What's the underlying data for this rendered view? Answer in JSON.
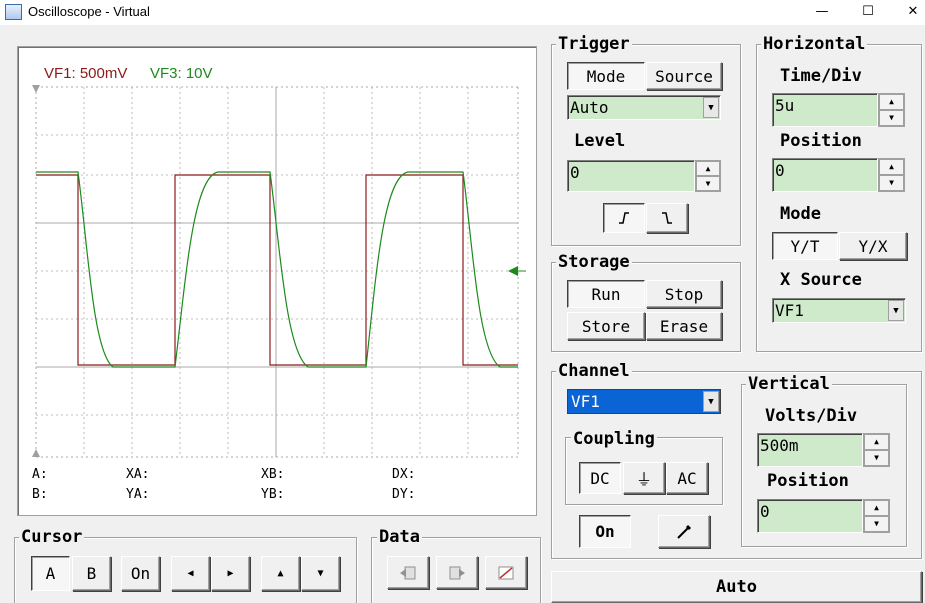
{
  "window": {
    "title": "Oscilloscope - Virtual",
    "minimize": "—",
    "maximize": "☐",
    "close": "✕"
  },
  "screen": {
    "ch1_label": "VF1: 500mV",
    "ch2_label": "VF3: 10V",
    "ch1_color": "#8b1a1a",
    "ch2_color": "#1d8a1d",
    "readouts": {
      "a": "A:",
      "xa": "XA:",
      "xb": "XB:",
      "dx": "DX:",
      "b": "B:",
      "ya": "YA:",
      "yb": "YB:",
      "dy": "DY:"
    }
  },
  "trigger": {
    "title": "Trigger",
    "tab_mode": "Mode",
    "tab_source": "Source",
    "mode_value": "Auto",
    "level_label": "Level",
    "level_value": "0",
    "rising_icon": "rising-edge-icon",
    "falling_icon": "falling-edge-icon"
  },
  "horizontal": {
    "title": "Horizontal",
    "timediv_label": "Time/Div",
    "timediv_value": "5u",
    "position_label": "Position",
    "position_value": "0",
    "mode_label": "Mode",
    "mode_yt": "Y/T",
    "mode_yx": "Y/X",
    "xsource_label": "X Source",
    "xsource_value": "VF1"
  },
  "storage": {
    "title": "Storage",
    "run": "Run",
    "stop": "Stop",
    "store": "Store",
    "erase": "Erase"
  },
  "channel": {
    "title": "Channel",
    "selected": "VF1",
    "coupling_label": "Coupling",
    "dc": "DC",
    "gnd": "⏚",
    "ac": "AC",
    "on": "On",
    "color_icon": "color-picker-icon"
  },
  "vertical": {
    "title": "Vertical",
    "voltsdiv_label": "Volts/Div",
    "voltsdiv_value": "500m",
    "position_label": "Position",
    "position_value": "0"
  },
  "cursor": {
    "title": "Cursor",
    "a": "A",
    "b": "B",
    "on": "On"
  },
  "data": {
    "title": "Data"
  },
  "auto": {
    "label": "Auto"
  }
}
